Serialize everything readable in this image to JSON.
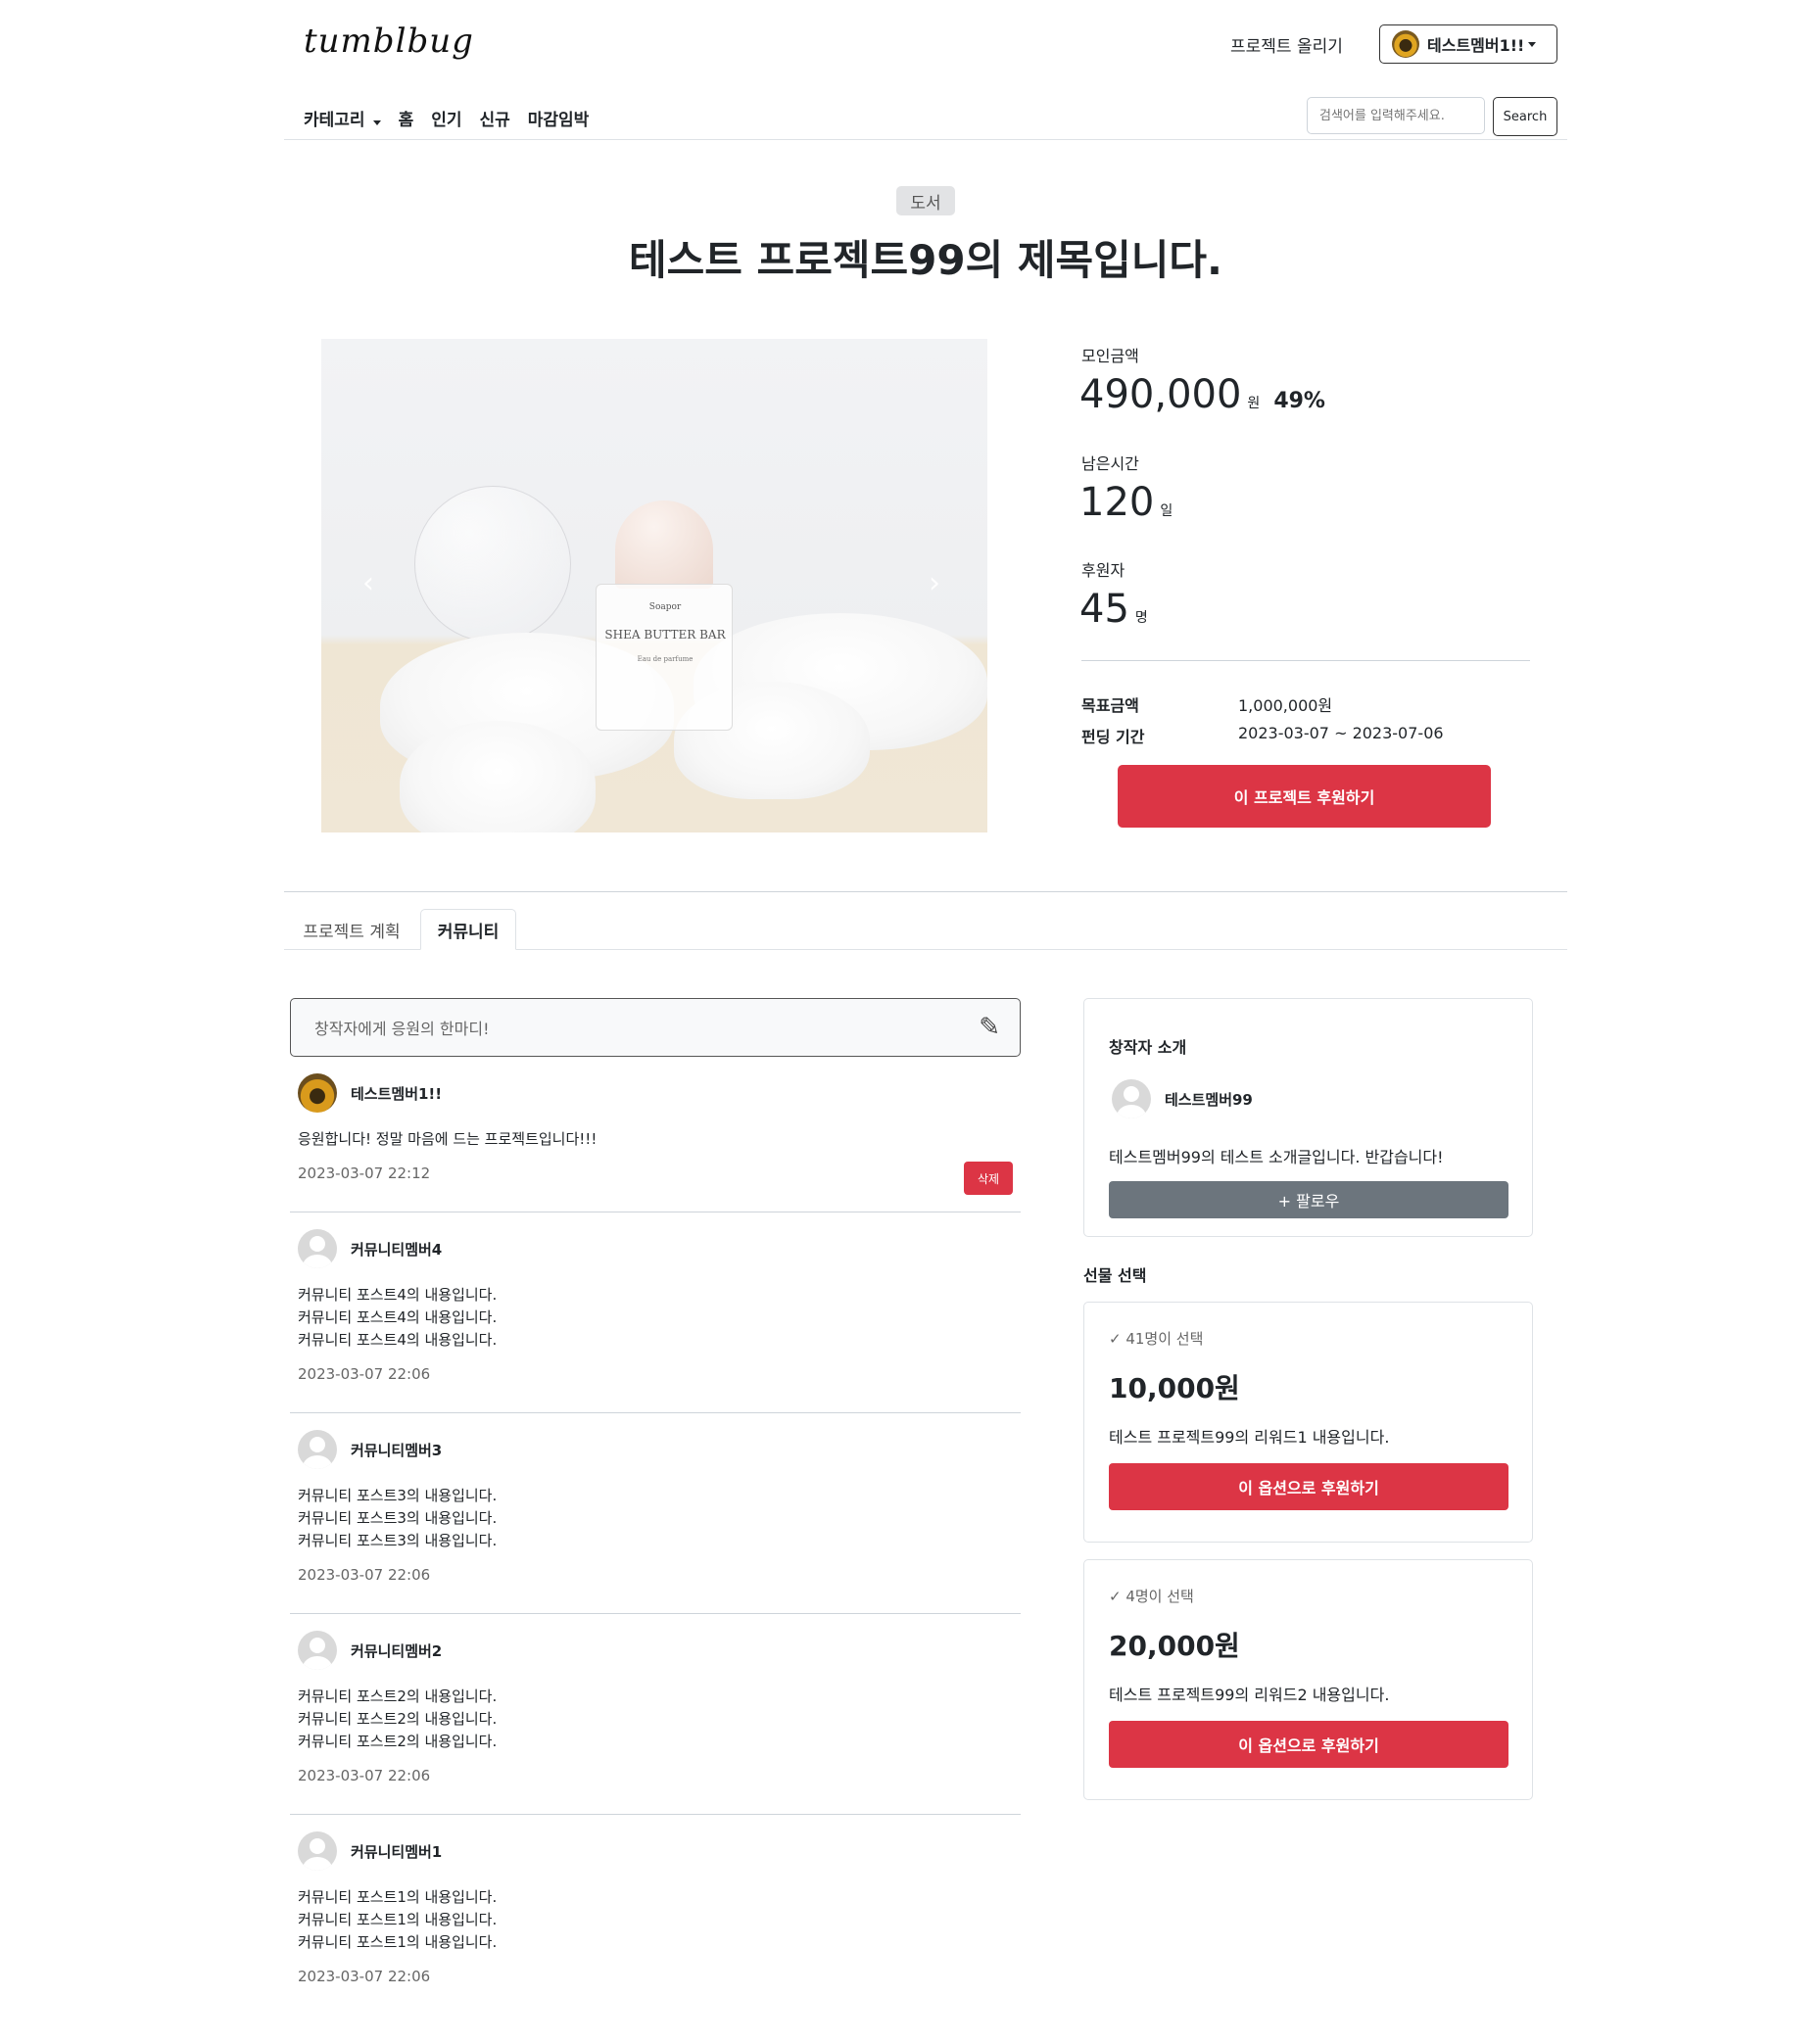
{
  "header": {
    "logo": "tumblbug",
    "upload_link": "프로젝트 올리기",
    "user_name": "테스트멤버1!!",
    "nav": [
      "카테고리",
      "홈",
      "인기",
      "신규",
      "마감임박"
    ],
    "search_placeholder": "검색어를 입력해주세요.",
    "search_button": "Search"
  },
  "project": {
    "category": "도서",
    "title": "테스트 프로젝트99의 제목입니다.",
    "image": {
      "brand": "Soapor",
      "name": "SHEA BUTTER BAR",
      "sub": "Eau de parfume"
    },
    "stats": {
      "raised_label": "모인금액",
      "raised_value": "490,000",
      "raised_unit": "원",
      "raised_percent": "49%",
      "remaining_label": "남은시간",
      "remaining_value": "120",
      "remaining_unit": "일",
      "backers_label": "후원자",
      "backers_value": "45",
      "backers_unit": "명"
    },
    "goal_label": "목표금액",
    "goal_value": "1,000,000원",
    "period_label": "펀딩 기간",
    "period_value": "2023-03-07 ~ 2023-07-06",
    "back_button": "이 프로젝트 후원하기"
  },
  "tabs": [
    "프로젝트 계획",
    "커뮤니티"
  ],
  "community": {
    "comment_placeholder": "창작자에게 응원의 한마디!",
    "posts": [
      {
        "author": "테스트멤버1!!",
        "lines": [
          "응원합니다! 정말 마음에 드는 프로젝트입니다!!!"
        ],
        "date": "2023-03-07 22:12",
        "delete_label": "삭제"
      },
      {
        "author": "커뮤니티멤버4",
        "lines": [
          "커뮤니티 포스트4의 내용입니다.",
          "커뮤니티 포스트4의 내용입니다.",
          "커뮤니티 포스트4의 내용입니다."
        ],
        "date": "2023-03-07 22:06"
      },
      {
        "author": "커뮤니티멤버3",
        "lines": [
          "커뮤니티 포스트3의 내용입니다.",
          "커뮤니티 포스트3의 내용입니다.",
          "커뮤니티 포스트3의 내용입니다."
        ],
        "date": "2023-03-07 22:06"
      },
      {
        "author": "커뮤니티멤버2",
        "lines": [
          "커뮤니티 포스트2의 내용입니다.",
          "커뮤니티 포스트2의 내용입니다.",
          "커뮤니티 포스트2의 내용입니다."
        ],
        "date": "2023-03-07 22:06"
      },
      {
        "author": "커뮤니티멤버1",
        "lines": [
          "커뮤니티 포스트1의 내용입니다.",
          "커뮤니티 포스트1의 내용입니다.",
          "커뮤니티 포스트1의 내용입니다."
        ],
        "date": "2023-03-07 22:06"
      }
    ]
  },
  "creator": {
    "title": "창작자 소개",
    "name": "테스트멤버99",
    "intro": "테스트멤버99의 테스트 소개글입니다. 반갑습니다!",
    "follow_button": "+ 팔로우"
  },
  "rewards": {
    "title": "선물 선택",
    "items": [
      {
        "count": "✓ 41명이 선택",
        "price": "10,000원",
        "desc": "테스트 프로젝트99의 리워드1 내용입니다.",
        "button": "이 옵션으로 후원하기"
      },
      {
        "count": "✓ 4명이 선택",
        "price": "20,000원",
        "desc": "테스트 프로젝트99의 리워드2 내용입니다.",
        "button": "이 옵션으로 후원하기"
      }
    ]
  }
}
